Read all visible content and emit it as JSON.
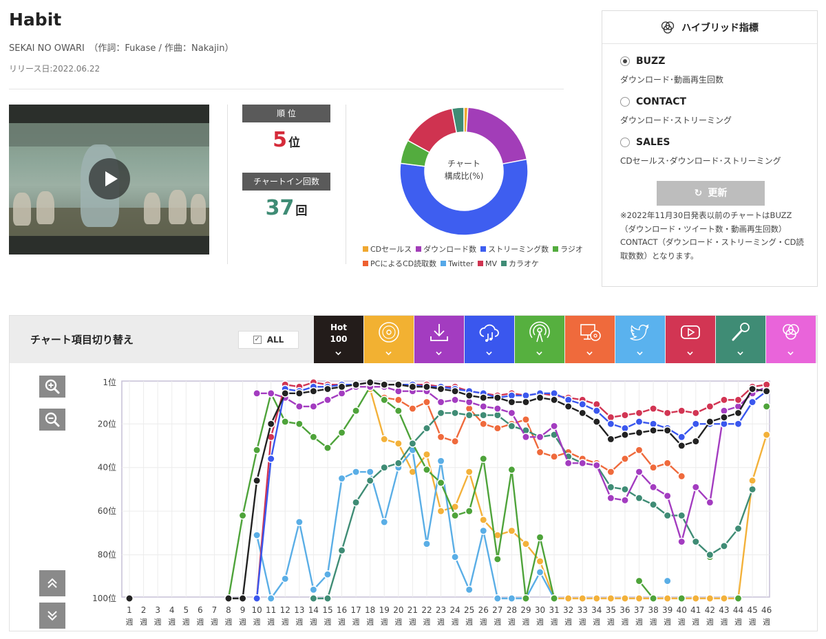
{
  "song": {
    "title": "Habit",
    "artist_line": "SEKAI NO OWARI　（作詞：Fukase / 作曲：Nakajin）",
    "release": "リリース日:2022.06.22"
  },
  "stats": {
    "rank_label": "順 位",
    "rank_value": "5",
    "rank_unit": "位",
    "chartin_label": "チャートイン回数",
    "chartin_value": "37",
    "chartin_unit": "回"
  },
  "donut": {
    "caption_line1": "チャート",
    "caption_line2": "構成比(%)",
    "segments": [
      {
        "name": "CDセールス",
        "value": 1,
        "color": "#f0a830"
      },
      {
        "name": "ダウンロード数",
        "value": 21,
        "color": "#a23db8"
      },
      {
        "name": "ストリーミング数",
        "value": 55,
        "color": "#3e5ef0"
      },
      {
        "name": "ラジオ",
        "value": 6,
        "color": "#53ac3e"
      },
      {
        "name": "PCによるCD読取数",
        "value": 0,
        "color": "#ee6030"
      },
      {
        "name": "Twitter",
        "value": 0,
        "color": "#55a8e8"
      },
      {
        "name": "MV",
        "value": 14,
        "color": "#cf3350"
      },
      {
        "name": "カラオケ",
        "value": 3,
        "color": "#3f8c75"
      }
    ]
  },
  "hybrid": {
    "title": "ハイブリッド指標",
    "options": [
      {
        "label": "BUZZ",
        "desc": "ダウンロード･動画再生回数",
        "selected": true
      },
      {
        "label": "CONTACT",
        "desc": "ダウンロード･ストリーミング",
        "selected": false
      },
      {
        "label": "SALES",
        "desc": "CDセールス･ダウンロード･ストリーミング",
        "selected": false
      }
    ],
    "update_label": "更新",
    "note": "※2022年11月30日発表以前のチャートはBUZZ（ダウンロード・ツイート数・動画再生回数）CONTACT（ダウンロード・ストリーミング・CD読取数数）となります。"
  },
  "toolbar": {
    "title": "チャート項目切り替え",
    "all_label": "ALL",
    "hot_label_1": "Hot",
    "hot_label_2": "100",
    "tabs": [
      {
        "icon": "hot100-icon",
        "color": "#231c1a"
      },
      {
        "icon": "cd-icon",
        "color": "#f2b132"
      },
      {
        "icon": "download-icon",
        "color": "#a33cc0"
      },
      {
        "icon": "streaming-icon",
        "color": "#3a57ee"
      },
      {
        "icon": "radio-icon",
        "color": "#56b03f"
      },
      {
        "icon": "pc-cd-icon",
        "color": "#ef6a3c"
      },
      {
        "icon": "twitter-icon",
        "color": "#5ab2ee"
      },
      {
        "icon": "mv-icon",
        "color": "#d23553"
      },
      {
        "icon": "karaoke-icon",
        "color": "#3f8c75"
      },
      {
        "icon": "hybrid-icon",
        "color": "#e964da"
      }
    ]
  },
  "chart_data": {
    "type": "line",
    "x": [
      1,
      2,
      3,
      4,
      5,
      6,
      7,
      8,
      9,
      10,
      11,
      12,
      13,
      14,
      15,
      16,
      17,
      18,
      19,
      20,
      21,
      22,
      23,
      24,
      25,
      26,
      27,
      28,
      29,
      30,
      31,
      32,
      33,
      34,
      35,
      36,
      37,
      38,
      39,
      40,
      41,
      42,
      43,
      44,
      45,
      46
    ],
    "x_tick_number_labels": [
      "1",
      "2",
      "3",
      "4",
      "5",
      "6",
      "7",
      "8",
      "9",
      "10",
      "11",
      "12",
      "13",
      "14",
      "15",
      "16",
      "17",
      "18",
      "19",
      "20",
      "21",
      "22",
      "23",
      "24",
      "25",
      "26",
      "27",
      "28",
      "29",
      "30",
      "31",
      "32",
      "33",
      "34",
      "35",
      "36",
      "37",
      "38",
      "39",
      "40",
      "41",
      "42",
      "43",
      "44",
      "45",
      "46"
    ],
    "x_tick_unit": "週",
    "y_ticks": [
      1,
      20,
      40,
      60,
      80,
      100
    ],
    "y_tick_labels": [
      "1位",
      "20位",
      "40位",
      "60位",
      "80位",
      "100位"
    ],
    "ylim": [
      100,
      1
    ],
    "y_inverted": true,
    "grid": true,
    "series": [
      {
        "key": "cd",
        "color": "#f3b13a",
        "values": [
          null,
          null,
          null,
          null,
          null,
          null,
          null,
          null,
          null,
          null,
          null,
          null,
          null,
          null,
          null,
          null,
          null,
          4,
          27,
          29,
          42,
          34,
          60,
          58,
          42,
          64,
          71,
          69,
          75,
          83,
          100,
          100,
          100,
          100,
          100,
          100,
          100,
          100,
          100,
          100,
          100,
          100,
          100,
          100,
          46,
          25
        ]
      },
      {
        "key": "pc",
        "color": "#ef6a3c",
        "values": [
          null,
          null,
          null,
          null,
          null,
          null,
          null,
          null,
          null,
          null,
          null,
          null,
          null,
          null,
          null,
          null,
          null,
          null,
          8,
          9,
          13,
          10,
          26,
          28,
          13,
          20,
          22,
          20,
          18,
          33,
          35,
          33,
          36,
          38,
          42,
          36,
          32,
          40,
          38,
          44,
          null,
          null,
          null,
          null,
          null,
          null
        ]
      },
      {
        "key": "twitter",
        "color": "#5aaee6",
        "values": [
          null,
          null,
          null,
          null,
          null,
          null,
          null,
          null,
          null,
          71,
          100,
          91,
          65,
          96,
          89,
          45,
          42,
          42,
          65,
          40,
          32,
          75,
          37,
          81,
          96,
          69,
          100,
          100,
          100,
          88,
          100,
          null,
          null,
          null,
          null,
          null,
          null,
          null,
          92,
          null,
          null,
          null,
          null,
          null,
          null,
          null
        ]
      },
      {
        "key": "radio",
        "color": "#4ea33a",
        "values": [
          null,
          null,
          null,
          null,
          null,
          null,
          null,
          100,
          62,
          32,
          6,
          19,
          20,
          26,
          31,
          24,
          14,
          3,
          9,
          14,
          29,
          41,
          47,
          62,
          60,
          36,
          82,
          41,
          100,
          72,
          100,
          null,
          null,
          null,
          null,
          null,
          92,
          100,
          null,
          100,
          null,
          81,
          null,
          100,
          null,
          12
        ]
      },
      {
        "key": "karaoke",
        "color": "#3f8c75",
        "values": [
          null,
          null,
          null,
          null,
          null,
          null,
          null,
          null,
          null,
          null,
          null,
          null,
          null,
          100,
          100,
          78,
          56,
          46,
          40,
          38,
          29,
          22,
          15,
          15,
          16,
          16,
          16,
          21,
          23,
          26,
          25,
          35,
          38,
          39,
          49,
          50,
          54,
          57,
          62,
          62,
          74,
          80,
          76,
          68,
          50,
          null
        ]
      },
      {
        "key": "download",
        "color": "#a33cc0",
        "values": [
          null,
          null,
          null,
          null,
          null,
          null,
          null,
          null,
          null,
          6,
          6,
          8,
          12,
          12,
          9,
          6,
          3,
          3,
          3,
          5,
          5,
          5,
          10,
          9,
          10,
          12,
          13,
          15,
          26,
          26,
          21,
          38,
          38,
          39,
          54,
          55,
          42,
          49,
          53,
          74,
          49,
          56,
          14,
          12,
          6,
          3
        ]
      },
      {
        "key": "mv",
        "color": "#d23553",
        "values": [
          null,
          null,
          null,
          null,
          null,
          null,
          null,
          null,
          null,
          100,
          26,
          2,
          3,
          1,
          2,
          2,
          2,
          1,
          2,
          2,
          2,
          2,
          3,
          3,
          5,
          6,
          7,
          6,
          7,
          6,
          7,
          8,
          9,
          11,
          17,
          16,
          15,
          13,
          15,
          14,
          15,
          12,
          9,
          9,
          3,
          2
        ]
      },
      {
        "key": "streaming",
        "color": "#3a57ee",
        "values": [
          null,
          null,
          null,
          null,
          null,
          null,
          null,
          null,
          null,
          100,
          36,
          4,
          5,
          3,
          3,
          2,
          2,
          1,
          2,
          2,
          2,
          3,
          3,
          4,
          5,
          6,
          8,
          7,
          7,
          6,
          6,
          9,
          11,
          14,
          20,
          22,
          19,
          20,
          22,
          26,
          20,
          20,
          20,
          20,
          10,
          5
        ]
      },
      {
        "key": "hot100",
        "color": "#222222",
        "values": [
          100,
          null,
          null,
          null,
          null,
          null,
          null,
          100,
          100,
          46,
          20,
          6,
          6,
          5,
          4,
          3,
          2,
          1,
          2,
          2,
          3,
          3,
          4,
          5,
          7,
          8,
          8,
          10,
          10,
          8,
          9,
          12,
          15,
          19,
          27,
          25,
          24,
          23,
          23,
          30,
          28,
          19,
          17,
          15,
          4,
          5
        ]
      }
    ]
  }
}
